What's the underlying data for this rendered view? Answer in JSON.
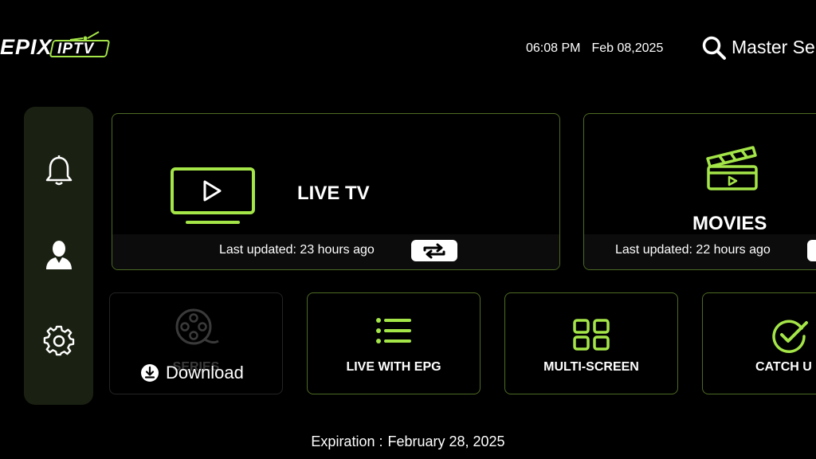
{
  "header": {
    "logo_text_1": "EPIX",
    "logo_text_2": "IPTV",
    "time": "06:08 PM",
    "date": "Feb 08,2025",
    "search_label": "Master Se"
  },
  "sidebar": {
    "items": [
      {
        "icon": "bell-icon"
      },
      {
        "icon": "user-icon"
      },
      {
        "icon": "gear-icon"
      }
    ]
  },
  "cards": {
    "live_tv": {
      "title": "LIVE TV",
      "updated": "Last updated: 23 hours ago"
    },
    "movies": {
      "title": "MOVIES",
      "updated": "Last updated: 22 hours ago"
    },
    "series": {
      "title": "SERIES",
      "download_label": "Download"
    },
    "live_epg": {
      "title": "LIVE WITH EPG"
    },
    "multi_screen": {
      "title": "MULTI-SCREEN"
    },
    "catch_up": {
      "title": "CATCH U"
    }
  },
  "footer": {
    "expiration_label": "Expiration :",
    "expiration_date": "February 28, 2025"
  },
  "colors": {
    "accent": "#a4e548",
    "card_border": "#4d6b24",
    "sidebar_bg": "#1a2112",
    "background": "#000000"
  }
}
